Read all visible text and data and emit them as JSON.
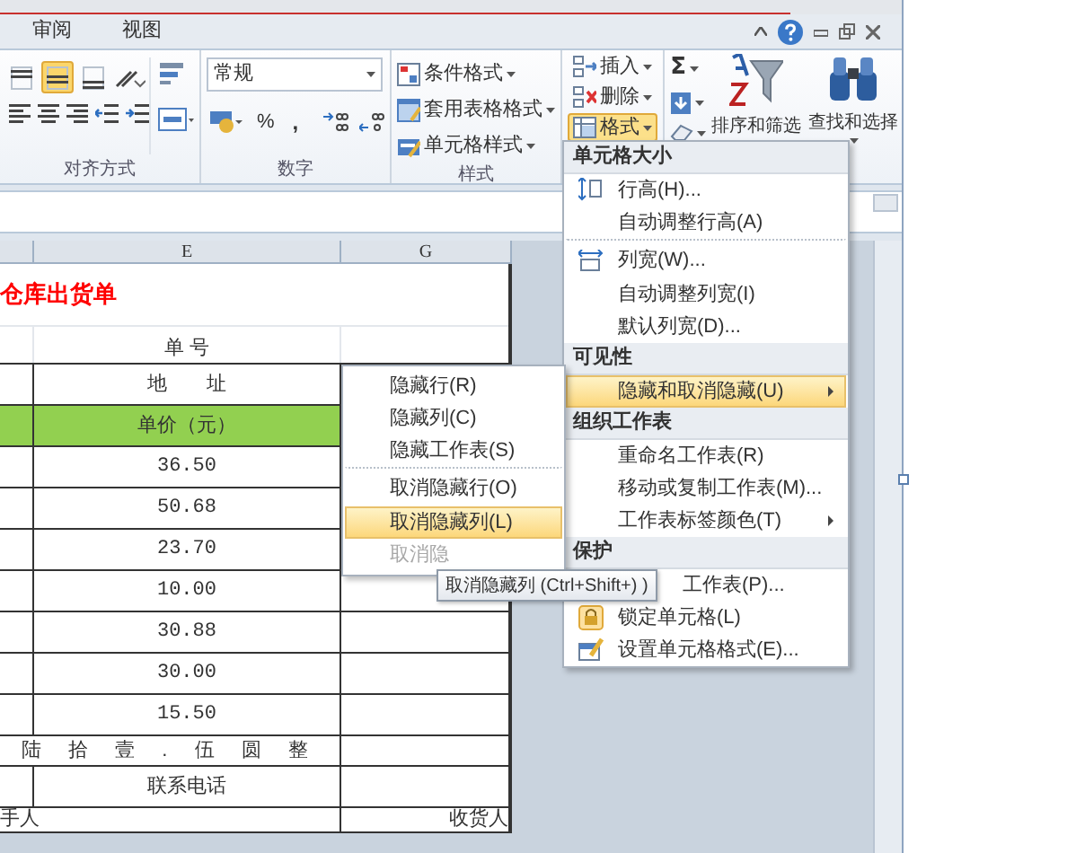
{
  "ribbon_tabs": [
    {
      "label": "审阅",
      "selected": false
    },
    {
      "label": "视图",
      "selected": false
    }
  ],
  "alignment": {
    "label": "对齐方式",
    "buttons": [
      {
        "kind": "top",
        "selected": false
      },
      {
        "kind": "middle",
        "selected": true
      },
      {
        "kind": "bottom",
        "selected": false
      }
    ]
  },
  "number": {
    "label": "数字",
    "format": "常规",
    "percent": "%",
    "comma": ","
  },
  "styles": {
    "label": "样式",
    "items": [
      "条件格式",
      "套用表格格式",
      "单元格样式"
    ]
  },
  "cells": {
    "items": [
      {
        "kind": "insert",
        "label": "插入",
        "selected": false
      },
      {
        "kind": "delete",
        "label": "删除",
        "selected": false
      },
      {
        "kind": "format",
        "label": "格式",
        "selected": true
      }
    ]
  },
  "editing": {
    "sum": "Σ",
    "items": [
      {
        "kind": "sort",
        "label": "排序和筛选"
      },
      {
        "kind": "find",
        "label": "查找和选择"
      }
    ]
  },
  "sheet": {
    "columns": [
      "E",
      "G"
    ],
    "rows": [
      {
        "kind": "title",
        "d": "仓库出货单"
      },
      {
        "kind": "label",
        "e": "单 号"
      },
      {
        "kind": "boxed",
        "e": "地　　址"
      },
      {
        "kind": "header",
        "e": "单价（元）"
      },
      {
        "kind": "data",
        "e": "36.50"
      },
      {
        "kind": "data",
        "e": "50.68"
      },
      {
        "kind": "data",
        "e": "23.70"
      },
      {
        "kind": "data",
        "e": "10.00"
      },
      {
        "kind": "data",
        "e": "30.88"
      },
      {
        "kind": "data",
        "e": "30.00"
      },
      {
        "kind": "data",
        "e": "15.50"
      },
      {
        "kind": "merged",
        "d": "陆 拾 壹 . 伍 圆 整"
      },
      {
        "kind": "boxed",
        "e": "联系电话"
      },
      {
        "kind": "sign",
        "d": "手人",
        "g": "收货人"
      }
    ]
  },
  "format_menu": {
    "sections": [
      {
        "header": "单元格大小",
        "items": [
          {
            "label": "行高(H)...",
            "kind": "row-height",
            "selected": false,
            "has_submenu": false
          },
          {
            "label": "自动调整行高(A)",
            "selected": false,
            "has_submenu": false
          },
          {
            "label": "列宽(W)...",
            "kind": "col-width",
            "selected": false,
            "has_submenu": false,
            "separator_before": true
          },
          {
            "label": "自动调整列宽(I)",
            "selected": false,
            "has_submenu": false
          },
          {
            "label": "默认列宽(D)...",
            "selected": false,
            "has_submenu": false
          }
        ]
      },
      {
        "header": "可见性",
        "items": [
          {
            "label": "隐藏和取消隐藏(U)",
            "selected": true,
            "has_submenu": true
          }
        ]
      },
      {
        "header": "组织工作表",
        "items": [
          {
            "label": "重命名工作表(R)",
            "selected": false,
            "has_submenu": false
          },
          {
            "label": "移动或复制工作表(M)...",
            "selected": false,
            "has_submenu": false
          },
          {
            "label": "工作表标签颜色(T)",
            "selected": false,
            "has_submenu": true
          }
        ]
      },
      {
        "header": "保护",
        "items": [
          {
            "label": "工作表(P)...",
            "kind": "covered",
            "selected": false,
            "has_submenu": false
          },
          {
            "label": "锁定单元格(L)",
            "kind": "lock",
            "selected": false,
            "has_submenu": false
          },
          {
            "label": "设置单元格格式(E)...",
            "kind": "format-cells",
            "selected": false,
            "has_submenu": false
          }
        ]
      }
    ]
  },
  "submenu": {
    "items": [
      {
        "label": "隐藏行(R)",
        "selected": false,
        "disabled": false
      },
      {
        "label": "隐藏列(C)",
        "selected": false,
        "disabled": false
      },
      {
        "label": "隐藏工作表(S)",
        "selected": false,
        "disabled": false
      },
      {
        "label": "取消隐藏行(O)",
        "selected": false,
        "disabled": false,
        "separator_before": true
      },
      {
        "label": "取消隐藏列(L)",
        "selected": true,
        "disabled": false
      },
      {
        "label": "取消隐",
        "selected": false,
        "disabled": true
      }
    ]
  },
  "tooltip": "取消隐藏列 (Ctrl+Shift+) )"
}
